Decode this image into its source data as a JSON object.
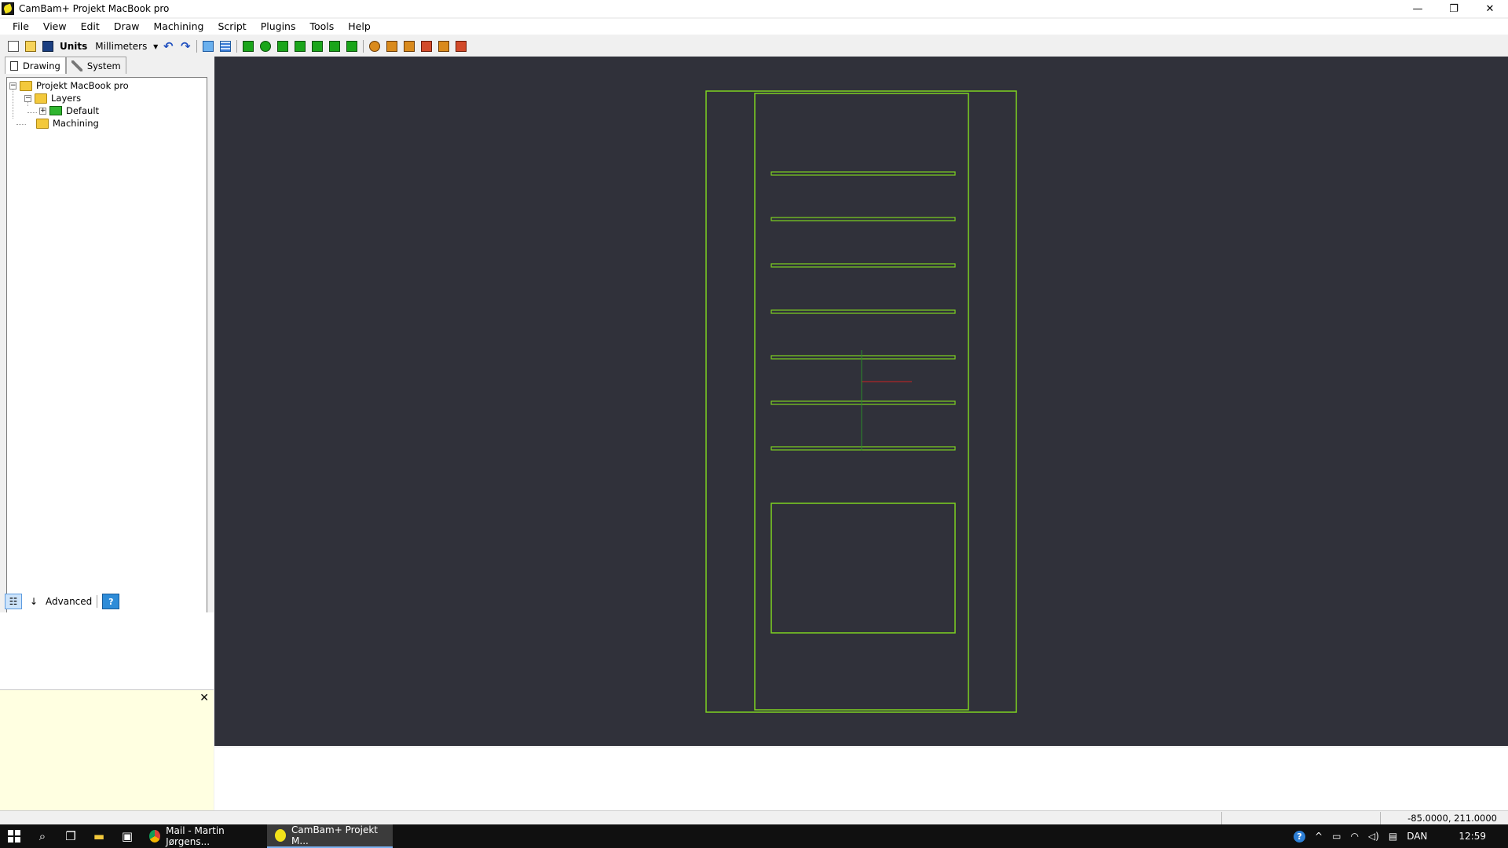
{
  "window": {
    "title": "CamBam+  Projekt MacBook pro",
    "controls": {
      "minimize": "—",
      "restore": "❐",
      "close": "✕"
    }
  },
  "menu": [
    "File",
    "View",
    "Edit",
    "Draw",
    "Machining",
    "Script",
    "Plugins",
    "Tools",
    "Help"
  ],
  "toolbar": {
    "units_label": "Units",
    "units_value": "Millimeters",
    "icons": [
      "new-file-icon",
      "open-folder-icon",
      "save-icon",
      "undo-icon",
      "redo-icon",
      "view-icon",
      "grid-icon",
      "polyline-icon",
      "circle-icon",
      "points-icon",
      "rectangle-icon",
      "text-icon",
      "polygon-icon",
      "3d-surface-icon",
      "profile-icon",
      "pocket-icon",
      "drill-icon",
      "engrave-icon",
      "lathe-icon",
      "3d-profile-icon"
    ]
  },
  "panel_tabs": [
    "Drawing",
    "System"
  ],
  "tree": {
    "root": "Projekt MacBook pro",
    "layers": "Layers",
    "default_layer": "Default",
    "machining": "Machining"
  },
  "properties": {
    "advanced_label": "Advanced",
    "help_glyph": "?"
  },
  "status": {
    "coordinates": "-85.0000, 211.0000"
  },
  "taskbar": {
    "apps": [
      "Mail - Martin Jørgens...",
      "CamBam+  Projekt M..."
    ],
    "language": "DAN",
    "time": "12:59"
  },
  "colors": {
    "canvas_bg": "#30313a",
    "geometry": "#7ed321",
    "axis_x": "#cc2222",
    "axis_y": "#2a8a2a",
    "highlight_cell": "#cde4fb"
  }
}
